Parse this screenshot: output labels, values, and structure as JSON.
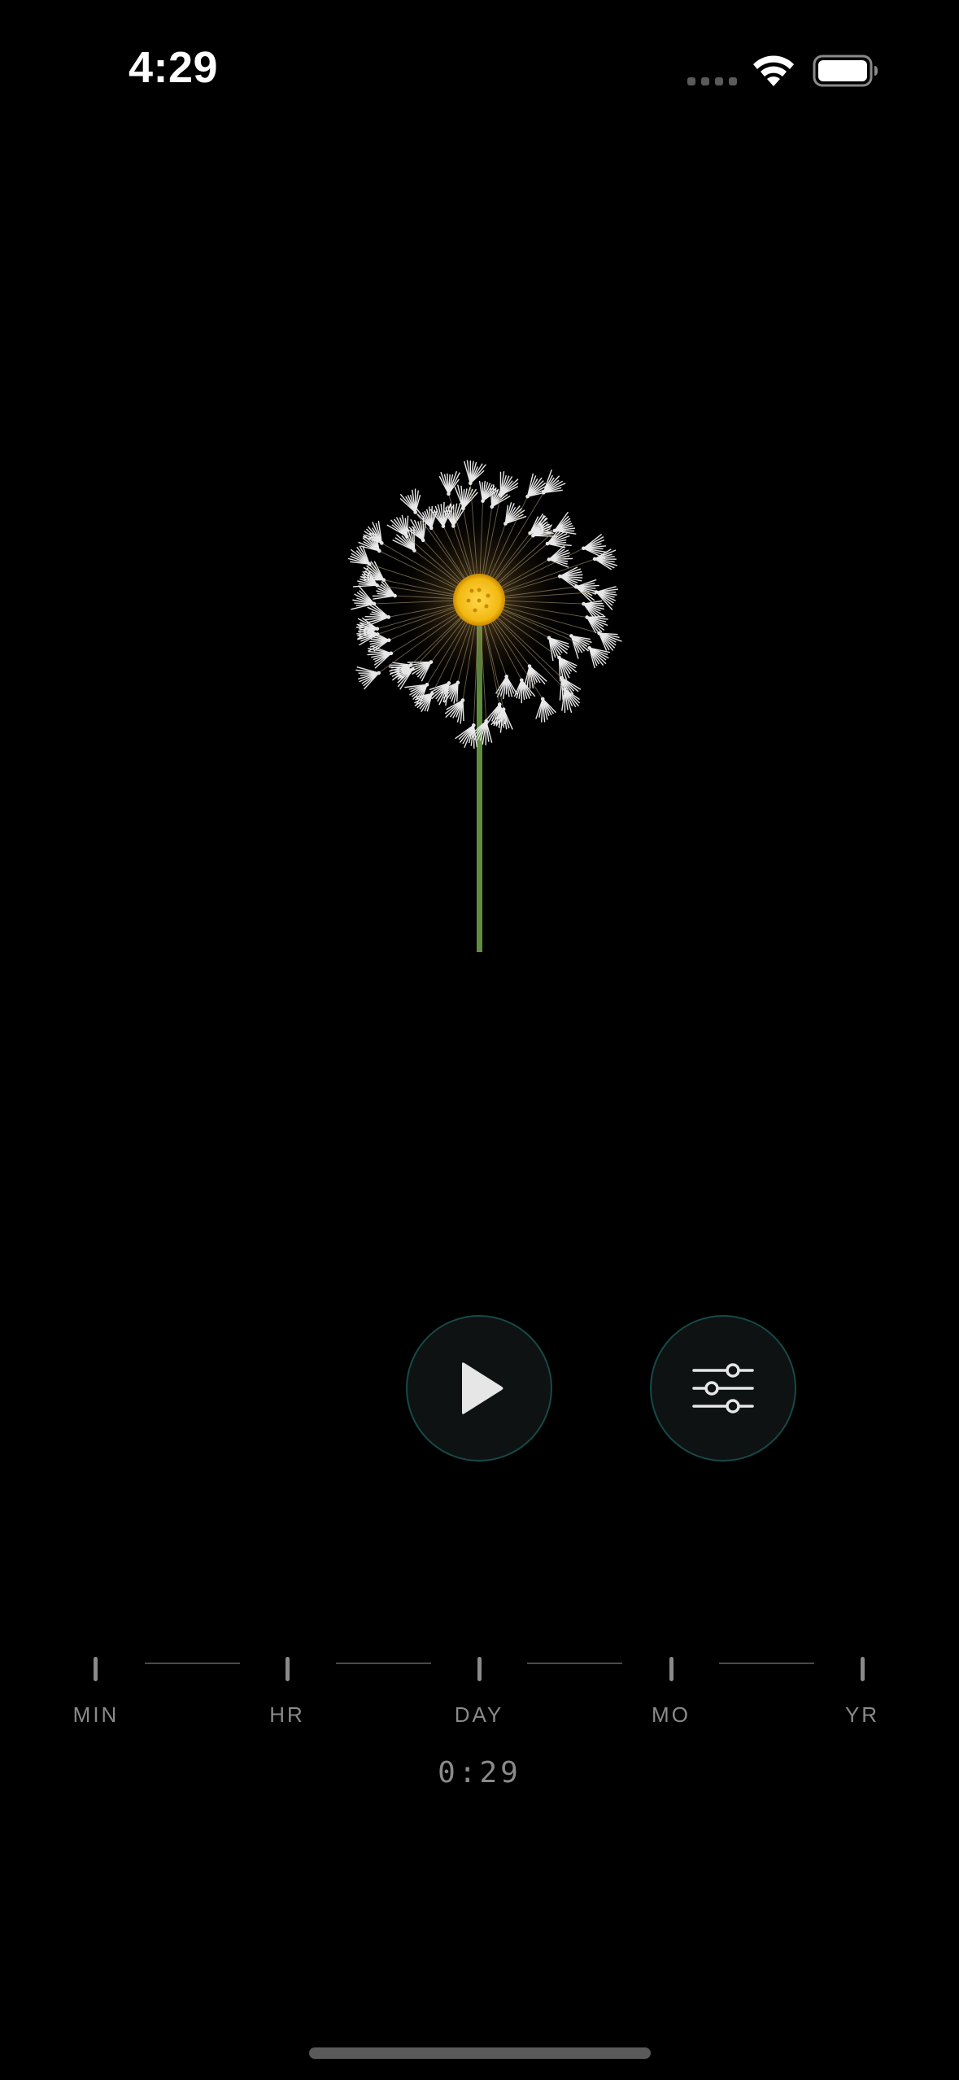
{
  "status_bar": {
    "time": "4:29",
    "icons": [
      "signal-dots-icon",
      "wifi-icon",
      "battery-icon"
    ]
  },
  "scene": {
    "subject": "dandelion-icon",
    "colors": {
      "background": "#000000",
      "seed_head_center": "#f5c518",
      "stem": "#5a8a3a",
      "button_border": "#164a48"
    }
  },
  "controls": {
    "play_icon": "play-icon",
    "settings_icon": "sliders-icon"
  },
  "timeline": {
    "labels": [
      "MIN",
      "HR",
      "DAY",
      "MO",
      "YR"
    ],
    "elapsed": "0:29"
  }
}
